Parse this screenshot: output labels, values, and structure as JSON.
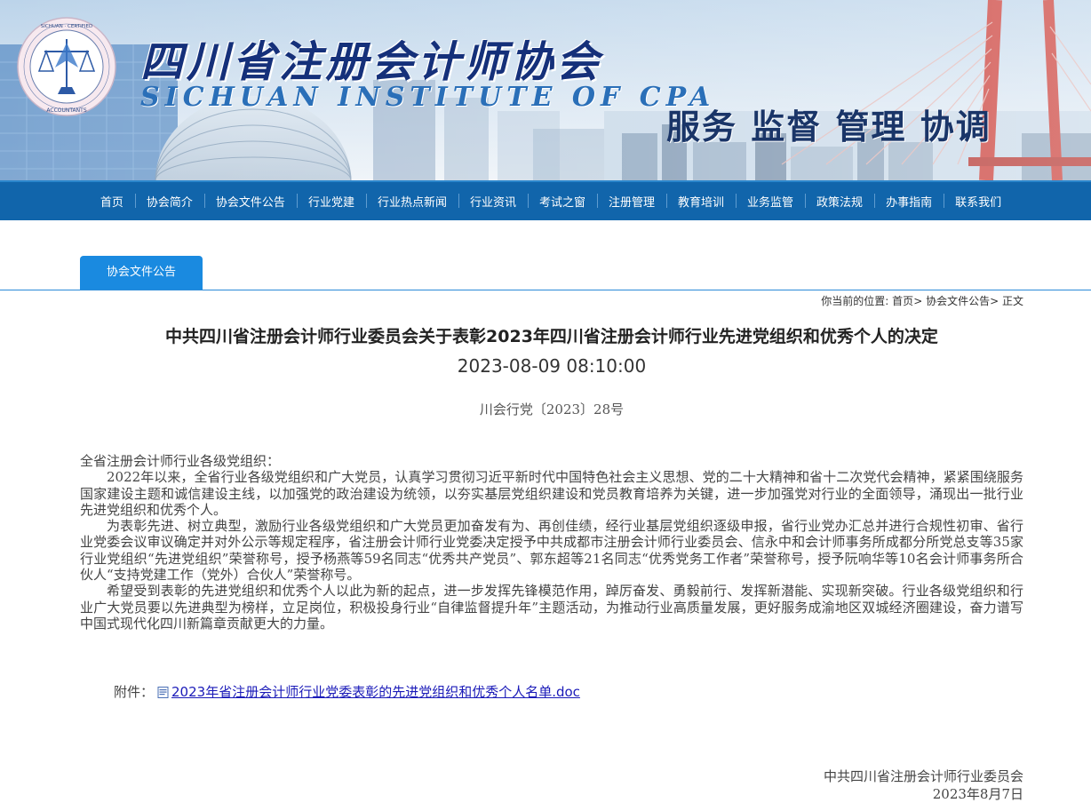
{
  "header": {
    "org_title": "四川省注册会计师协会",
    "org_english": "SICHUAN INSTITUTE OF CPA",
    "slogan": "服务 监督 管理 协调",
    "seal_text": "SICHUAN INSTITUTE OF CERTIFIED PUBLIC ACCOUNTANTS"
  },
  "nav": {
    "items": [
      "首页",
      "协会简介",
      "协会文件公告",
      "行业党建",
      "行业热点新闻",
      "行业资讯",
      "考试之窗",
      "注册管理",
      "教育培训",
      "业务监管",
      "政策法规",
      "办事指南",
      "联系我们"
    ]
  },
  "column_tab": "协会文件公告",
  "breadcrumb": {
    "prefix": "你当前的位置:",
    "home": "首页",
    "category": "协会文件公告",
    "current": "正文",
    "sep": ">"
  },
  "article": {
    "title": "中共四川省注册会计师行业委员会关于表彰2023年四川省注册会计师行业先进党组织和优秀个人的决定",
    "datetime": "2023-08-09 08:10:00",
    "doc_number": "川会行党〔2023〕28号",
    "salutation": "全省注册会计师行业各级党组织：",
    "paragraphs": [
      "2022年以来，全省行业各级党组织和广大党员，认真学习贯彻习近平新时代中国特色社会主义思想、党的二十大精神和省十二次党代会精神，紧紧围绕服务国家建设主题和诚信建设主线，以加强党的政治建设为统领，以夯实基层党组织建设和党员教育培养为关键，进一步加强党对行业的全面领导，涌现出一批行业先进党组织和优秀个人。",
      "为表彰先进、树立典型，激励行业各级党组织和广大党员更加奋发有为、再创佳绩，经行业基层党组织逐级申报，省行业党办汇总并进行合规性初审、省行业党委会议审议确定并对外公示等规定程序，省注册会计师行业党委决定授予中共成都市注册会计师行业委员会、信永中和会计师事务所成都分所党总支等35家行业党组织“先进党组织”荣誉称号，授予杨燕等59名同志“优秀共产党员”、郭东超等21名同志“优秀党务工作者”荣誉称号，授予阮响华等10名会计师事务所合伙人“支持党建工作（党外）合伙人”荣誉称号。",
      "希望受到表彰的先进党组织和优秀个人以此为新的起点，进一步发挥先锋模范作用，踔厉奋发、勇毅前行、发挥新潜能、实现新突破。行业各级党组织和行业广大党员要以先进典型为榜样，立足岗位，积极投身行业“自律监督提升年”主题活动，为推动行业高质量发展，更好服务成渝地区双城经济圈建设，奋力谱写中国式现代化四川新篇章贡献更大的力量。"
    ],
    "attachment_label": "附件：",
    "attachment_link": "2023年省注册会计师行业党委表彰的先进党组织和优秀个人名单.doc",
    "signature_org": "中共四川省注册会计师行业委员会",
    "signature_date": "2023年8月7日"
  },
  "colors": {
    "nav_bg": "#1165ab",
    "tab_bg": "#1a8ae0",
    "link": "#1a1ab8"
  }
}
